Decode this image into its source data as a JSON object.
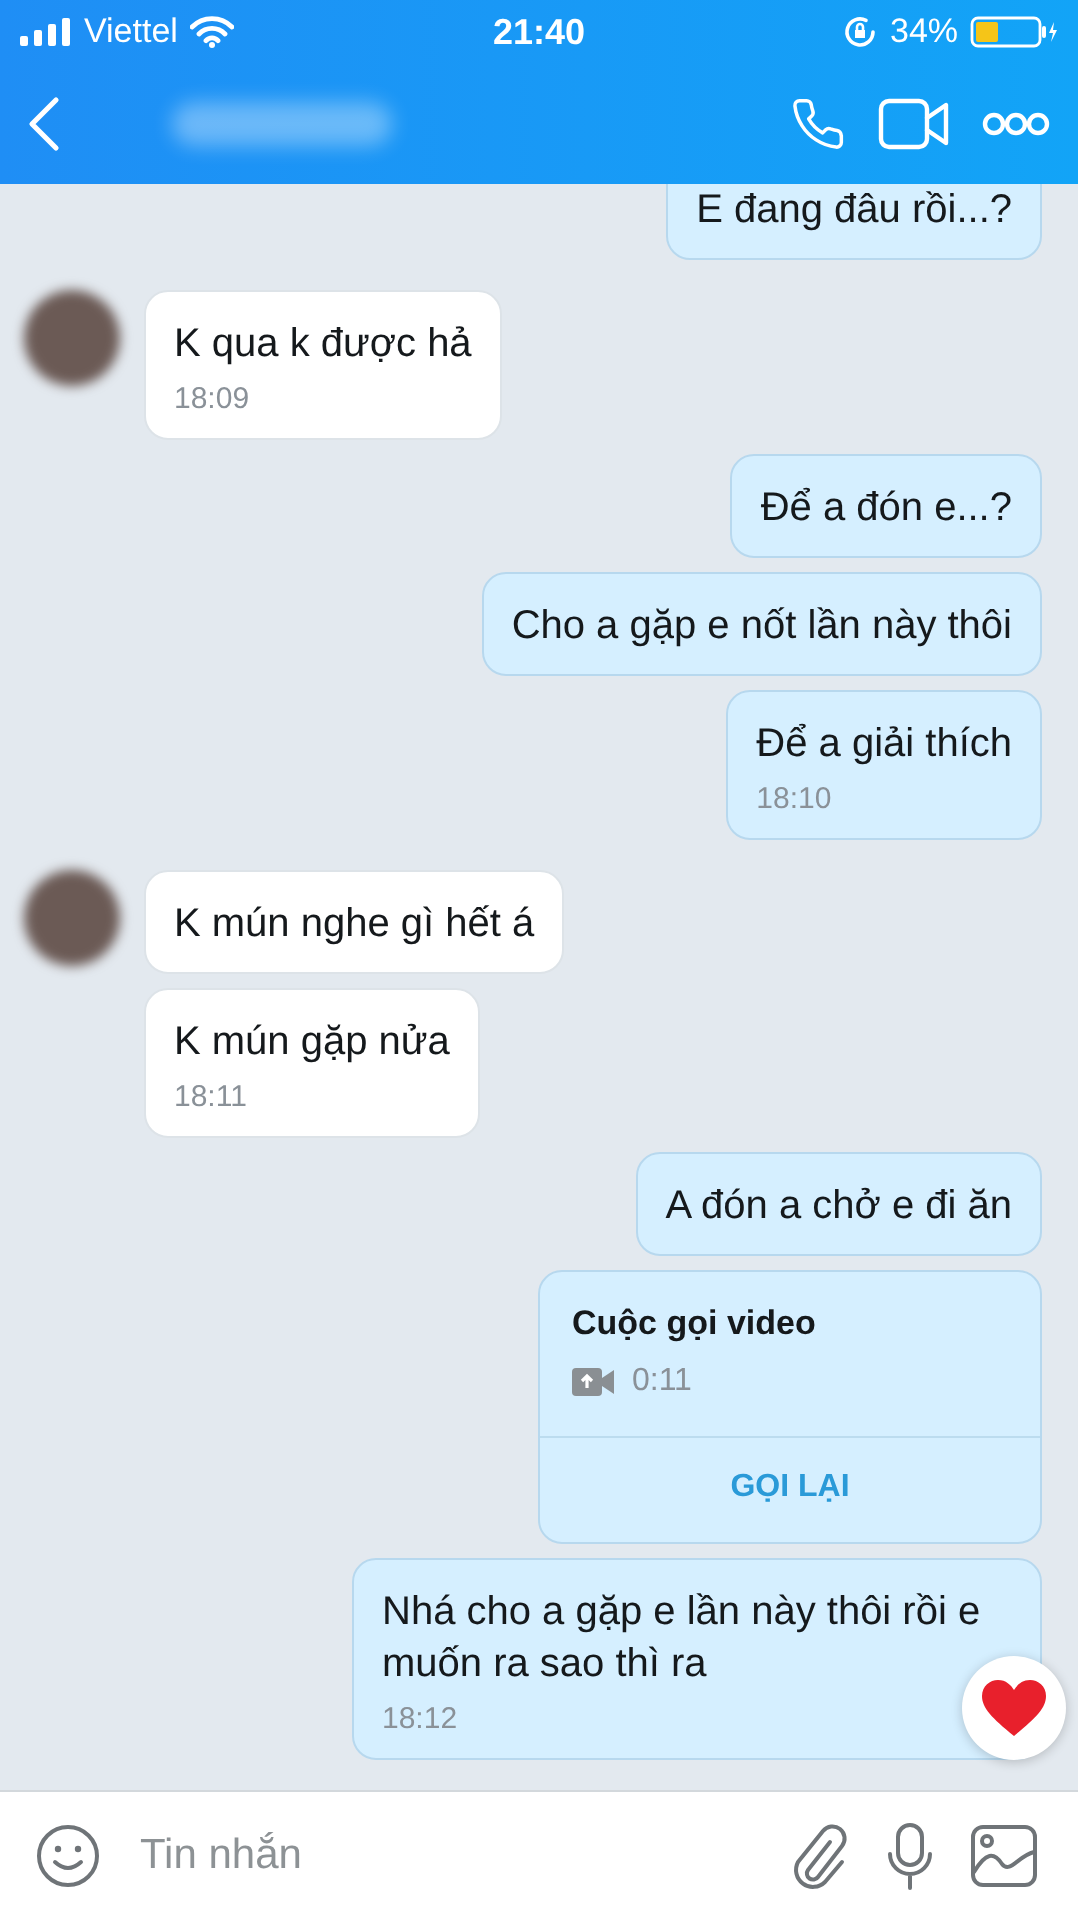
{
  "status_bar": {
    "carrier": "Viettel",
    "time": "21:40",
    "battery": "34%"
  },
  "messages": [
    {
      "kind": "text",
      "outgoing": true,
      "text": "E đang đâu rồi...?"
    },
    {
      "kind": "text",
      "outgoing": false,
      "avatar": true,
      "text": "K qua k được hả",
      "time": "18:09"
    },
    {
      "kind": "text",
      "outgoing": true,
      "text": "Để a đón e...?"
    },
    {
      "kind": "text",
      "outgoing": true,
      "text": "Cho a gặp e nốt lần này thôi"
    },
    {
      "kind": "text",
      "outgoing": true,
      "text": "Để a giải thích",
      "time": "18:10"
    },
    {
      "kind": "text",
      "outgoing": false,
      "avatar": true,
      "text": "K mún nghe gì hết á"
    },
    {
      "kind": "text",
      "outgoing": false,
      "avatar": false,
      "text": "K mún gặp nửa",
      "time": "18:11"
    },
    {
      "kind": "text",
      "outgoing": true,
      "text": "A đón a chở e đi ăn"
    },
    {
      "kind": "call",
      "outgoing": true,
      "title": "Cuộc gọi video",
      "duration": "0:11",
      "action": "GỌI LẠI"
    },
    {
      "kind": "text",
      "outgoing": true,
      "text": "Nhá cho a gặp e lần này thôi rồi e muốn ra sao thì ra",
      "time": "18:12",
      "reaction": true
    }
  ],
  "composer": {
    "placeholder": "Tin nhắn"
  }
}
